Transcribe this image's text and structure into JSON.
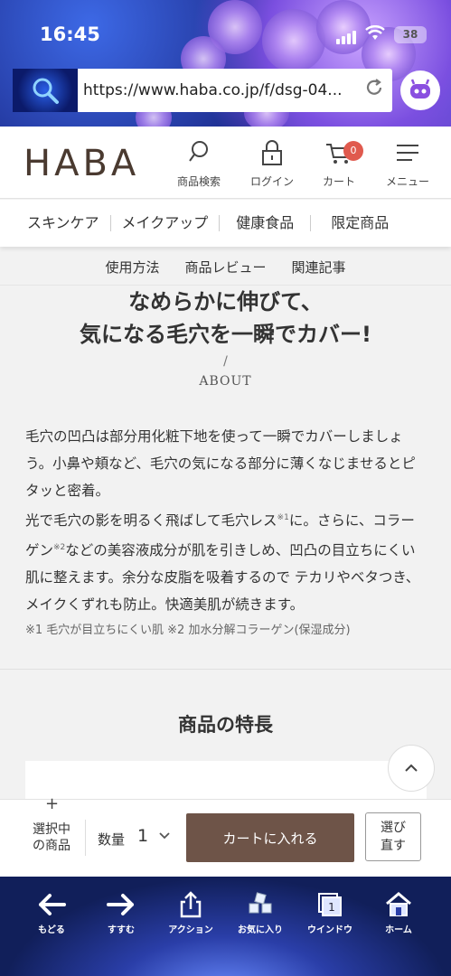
{
  "status": {
    "time": "16:45",
    "battery": "38"
  },
  "browser": {
    "url": "https://www.haba.co.jp/f/dsg-04..."
  },
  "header": {
    "logo": "HABA",
    "icons": [
      {
        "label": "商品検索",
        "icon": "search-icon"
      },
      {
        "label": "ログイン",
        "icon": "lock-icon"
      },
      {
        "label": "カート",
        "icon": "cart-icon",
        "badge": "0"
      },
      {
        "label": "メニュー",
        "icon": "menu-icon"
      }
    ]
  },
  "categories": [
    "スキンケア",
    "メイクアップ",
    "健康食品",
    "限定商品"
  ],
  "subnav": [
    "使用方法",
    "商品レビュー",
    "関連記事"
  ],
  "main": {
    "heading_line1": "なめらかに伸びて、",
    "heading_line2": "気になる毛穴を一瞬でカバー!",
    "slash": "/",
    "section_label": "ABOUT",
    "paragraph1": "毛穴の凹凸は部分用化粧下地を使って一瞬でカバーしましょう。小鼻や頬など、毛穴の気になる部分に薄くなじませるとピタッと密着。",
    "paragraph2_a": "光で毛穴の影を明るく飛ばして毛穴レス",
    "paragraph2_sup1": "※1",
    "paragraph2_b": "に。さらに、コラーゲン",
    "paragraph2_sup2": "※2",
    "paragraph2_c": "などの美容液成分が肌を引きしめ、凹凸の目立ちにくい肌に整えます。余分な皮脂を吸着するので テカリやベタつき、メイクくずれも防止。快適美肌が続きます。",
    "notes": "※1 毛穴が目立ちにくい肌 ※2 加水分解コラーゲン(保湿成分)",
    "features_title": "商品の特長"
  },
  "cartbar": {
    "plus": "+",
    "selected_line1": "選択中",
    "selected_line2": "の商品",
    "qty_label": "数量",
    "qty_value": "1",
    "add_to_cart": "カートに入れる",
    "reselect_line1": "選び",
    "reselect_line2": "直す"
  },
  "toolbar": [
    {
      "label": "もどる",
      "icon": "back-arrow-icon"
    },
    {
      "label": "すすむ",
      "icon": "forward-arrow-icon"
    },
    {
      "label": "アクション",
      "icon": "share-icon"
    },
    {
      "label": "お気に入り",
      "icon": "bookmarks-icon"
    },
    {
      "label": "ウインドウ",
      "icon": "windows-icon",
      "count": "1"
    },
    {
      "label": "ホーム",
      "icon": "home-icon"
    }
  ],
  "colors": {
    "brand": "#4a3a30",
    "cart_button": "#6e5448",
    "badge": "#e05a4e"
  }
}
